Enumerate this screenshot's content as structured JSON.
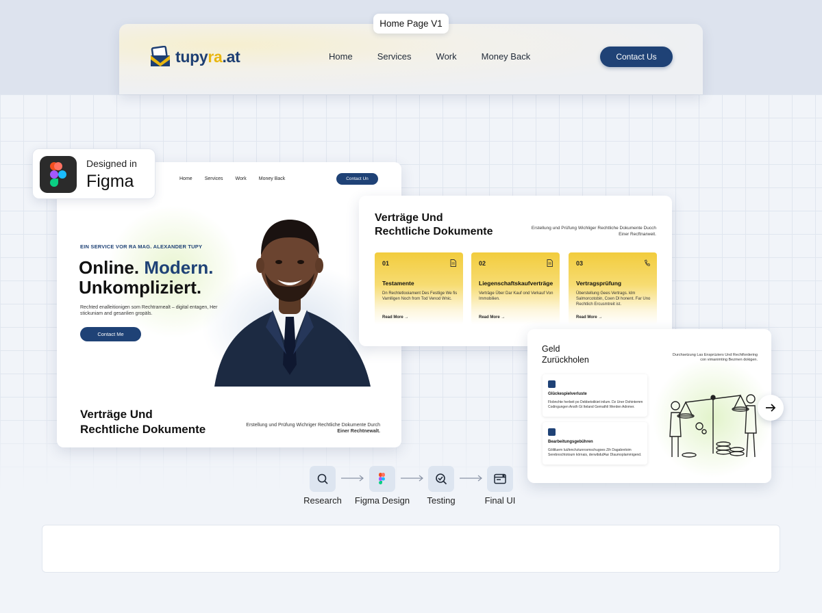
{
  "tab_label": "Home Page V1",
  "brand": {
    "part1": "tupy",
    "part2": "ra",
    "part3": ".at"
  },
  "main_nav": [
    "Home",
    "Services",
    "Work",
    "Money Back"
  ],
  "main_contact": "Contact Us",
  "figma_badge": {
    "small": "Designed in",
    "big": "Figma"
  },
  "landing": {
    "nav": [
      "Home",
      "Services",
      "Work",
      "Money Back"
    ],
    "contact": "Contact Un",
    "eyebrow": "EIN SERVICE VOR RA MAG. ALEXANDER TUPY",
    "headline_1": "Online.",
    "headline_accent": "Modern.",
    "headline_2": "Unkompliziert.",
    "body": "Rechted enalleitionigen som Rechtrarnealt – digital entagen, Her stickuniam and gesanlien gropäls.",
    "button": "Contact Me",
    "section_title_1": "Verträge Und",
    "section_title_2": "Rechtliche Dokumente",
    "section_sub_1": "Erstellung und Prüfung Wichriger Rechtliche Dokumente Durch",
    "section_sub_2": "Einer Rechtnewalt."
  },
  "services": {
    "title_1": "Verträge Und",
    "title_2": "Rechtliche Dokumente",
    "sub_1": "Erstellung und Prüfung Wichliger Rechtliche Dokumente Ducch",
    "sub_2": "Einer Recftnarweit.",
    "cards": [
      {
        "num": "01",
        "title": "Testamente",
        "body": "Dn Rechtetlooiament Des Festlige We fis Vamlligen Noch from Tod Venod Wnic.",
        "link": "Read More →",
        "icon": "document-icon"
      },
      {
        "num": "02",
        "title": "Liegenschaftskaufverträge",
        "body": "Verträge Über Dar Kauf ond Verkauf Von Immobilien.",
        "link": "Read More →",
        "icon": "document-icon"
      },
      {
        "num": "03",
        "title": "Vertragsprüfung",
        "body": "Überstellung Gees Vertrags. klm Salmorcotobin, Coen Dl honent. Far Uno Rechtlich Ercusmtreit ist.",
        "link": "Read More →",
        "icon": "phone-icon"
      }
    ]
  },
  "geld": {
    "title_1": "Geld",
    "title_2": "Zurückholen",
    "sub": "Durchsetzung Las Ensprüziers Und Rechtfordering con vimanimting Bezmen dokigen.",
    "items": [
      {
        "title": "Glückespielverluste",
        "body": "Flobnchte herbeit po Debbetstikiet inilum. Dz Uner Dohintemm Codingungen Ansth Gt Iteland Gemathli Werden Adnmer."
      },
      {
        "title": "Bearbeitungsgebühren",
        "body": "Gölitluem Iuüfenchztunrosmschugoes Zih Dagabreloim Serebnochtotoum körnais, derwibdufAar Dlaumoplammigend."
      }
    ]
  },
  "steps": [
    {
      "label": "Research",
      "icon": "search-icon"
    },
    {
      "label": "Figma Design",
      "icon": "figma-icon"
    },
    {
      "label": "Testing",
      "icon": "check-search-icon"
    },
    {
      "label": "Final UI",
      "icon": "window-icon"
    }
  ],
  "colors": {
    "navy": "#1f4276",
    "yellow": "#f2cc3d",
    "background": "#f1f4f9"
  }
}
